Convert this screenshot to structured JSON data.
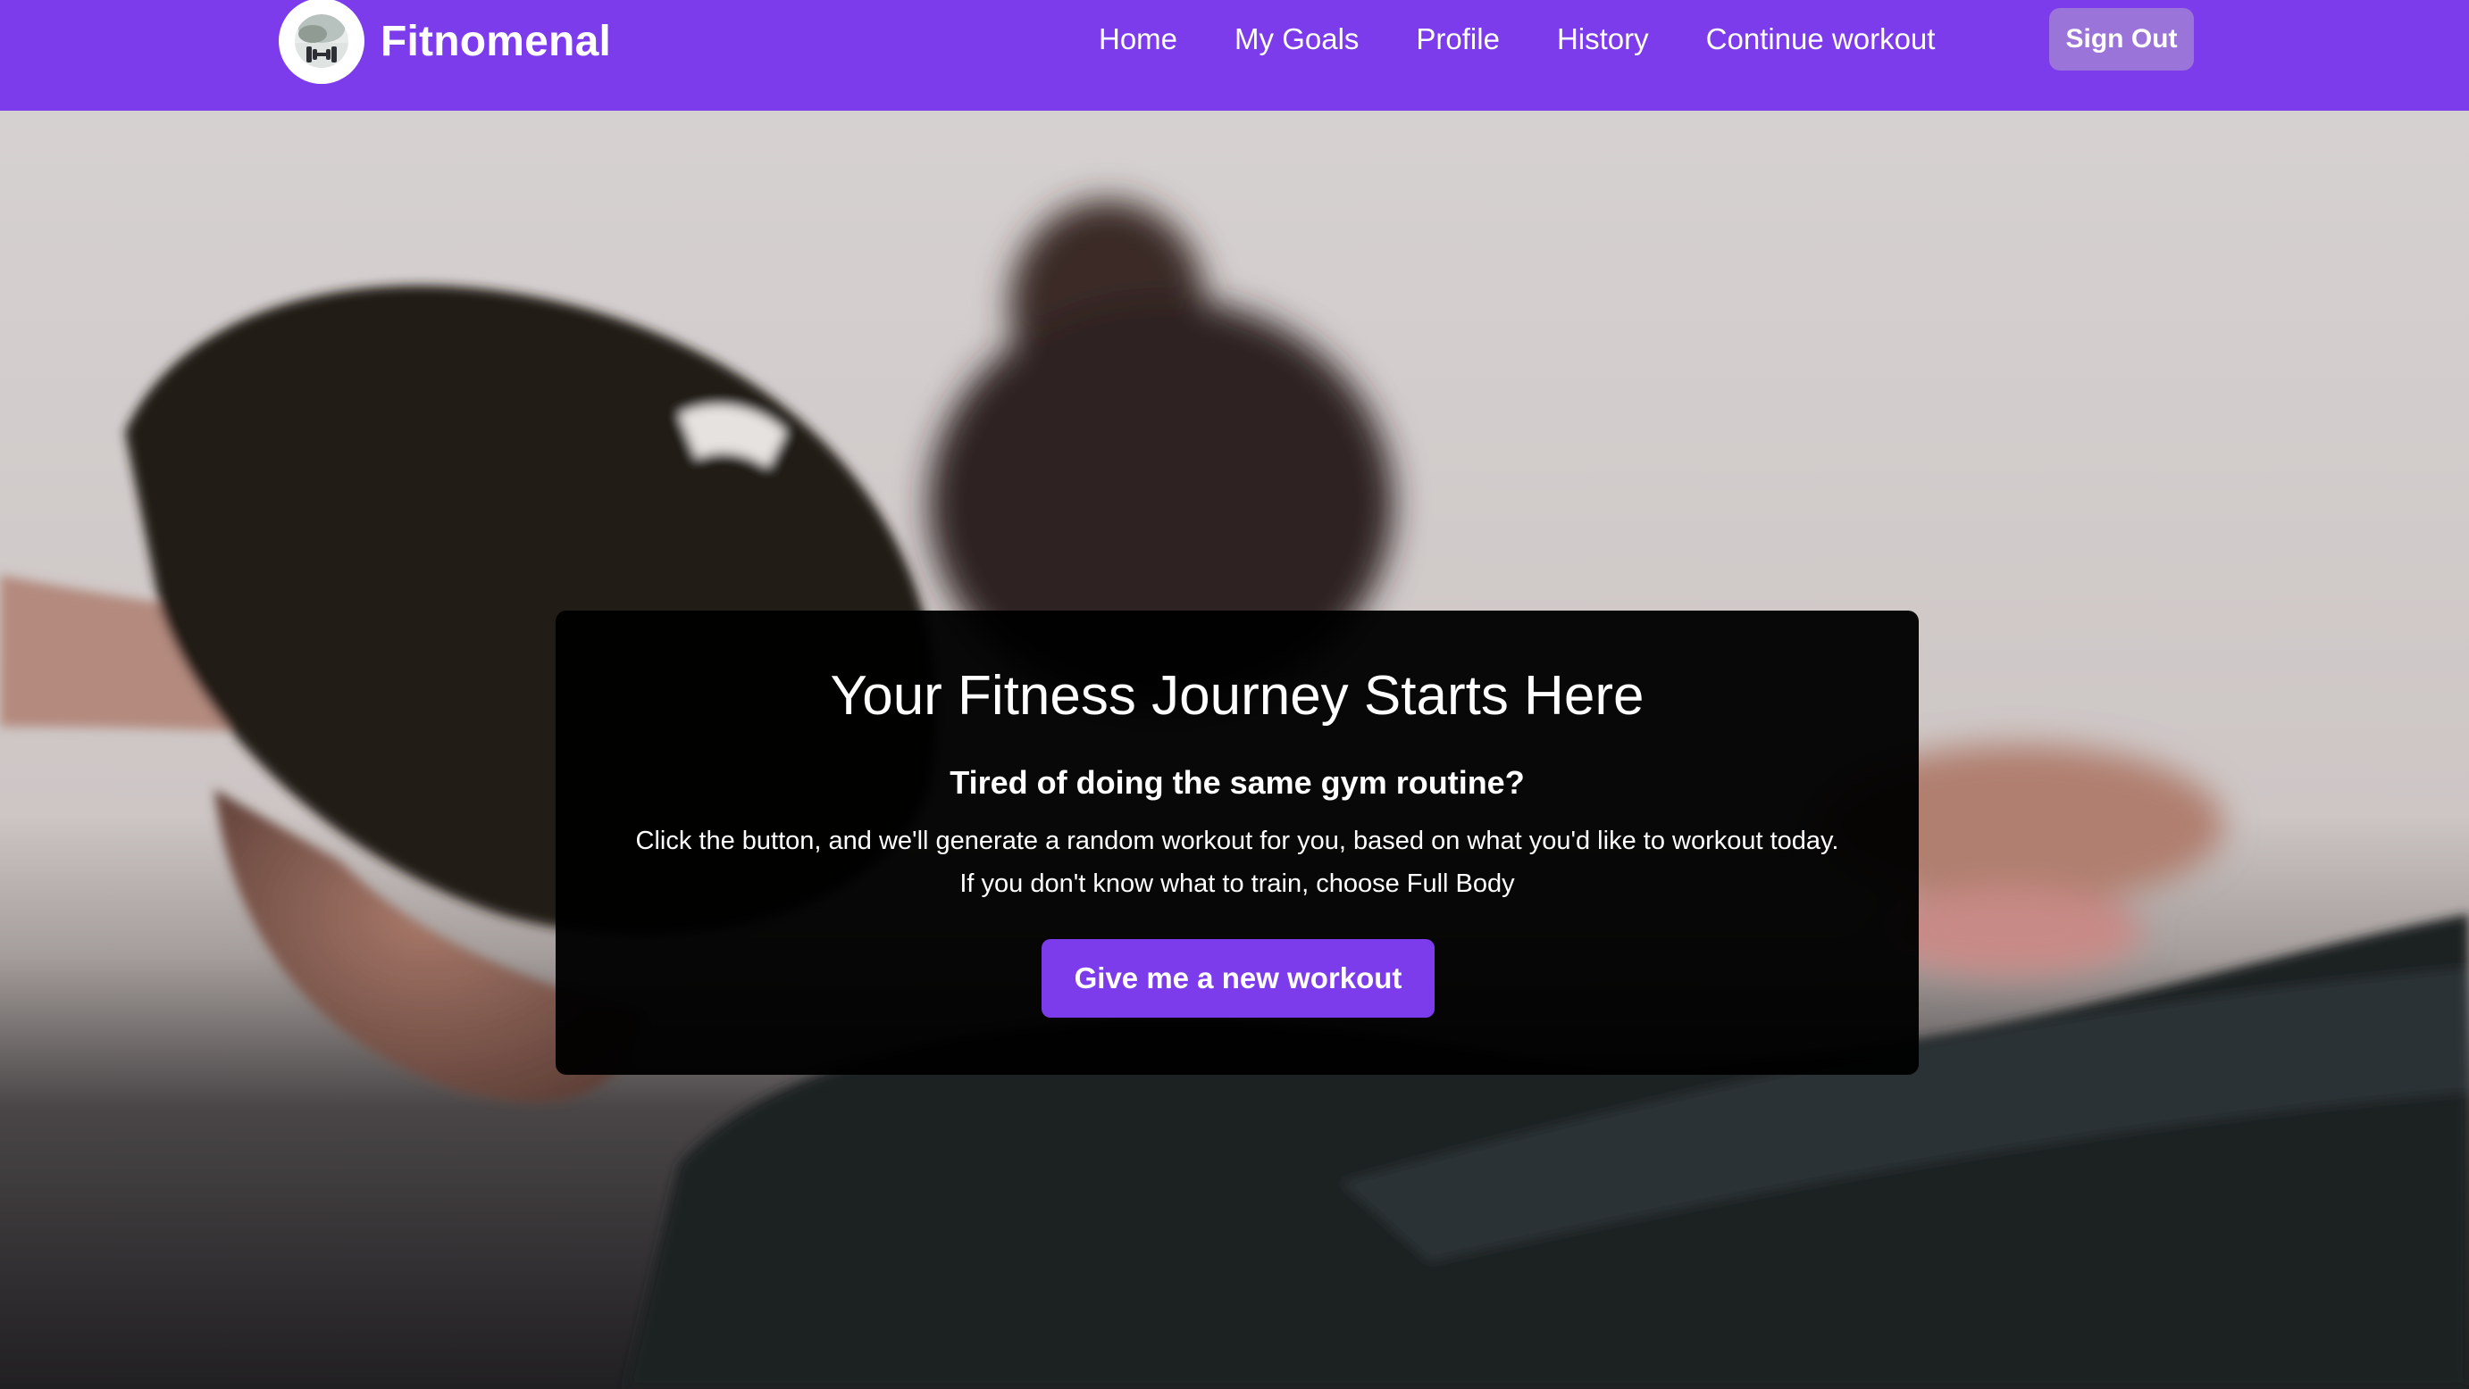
{
  "colors": {
    "navbar": "#7d3cec",
    "sign_out_button": "#9a74d9",
    "cta_button": "#7d3cec",
    "card_background": "#000000",
    "text": "#ffffff"
  },
  "brand": {
    "name": "Fitnomenal",
    "logo_icon": "dumbbell-logo-icon"
  },
  "nav": {
    "items": [
      {
        "label": "Home"
      },
      {
        "label": "My Goals"
      },
      {
        "label": "Profile"
      },
      {
        "label": "History"
      },
      {
        "label": "Continue workout"
      }
    ],
    "sign_out_label": "Sign Out"
  },
  "hero": {
    "title": "Your Fitness Journey Starts Here",
    "subtitle": "Tired of doing the same gym routine?",
    "description_line1": "Click the button, and we'll generate a random workout for you, based on what you'd like to workout today.",
    "description_line2": "If you don't know what to train, choose Full Body",
    "cta_label": "Give me a new workout"
  }
}
